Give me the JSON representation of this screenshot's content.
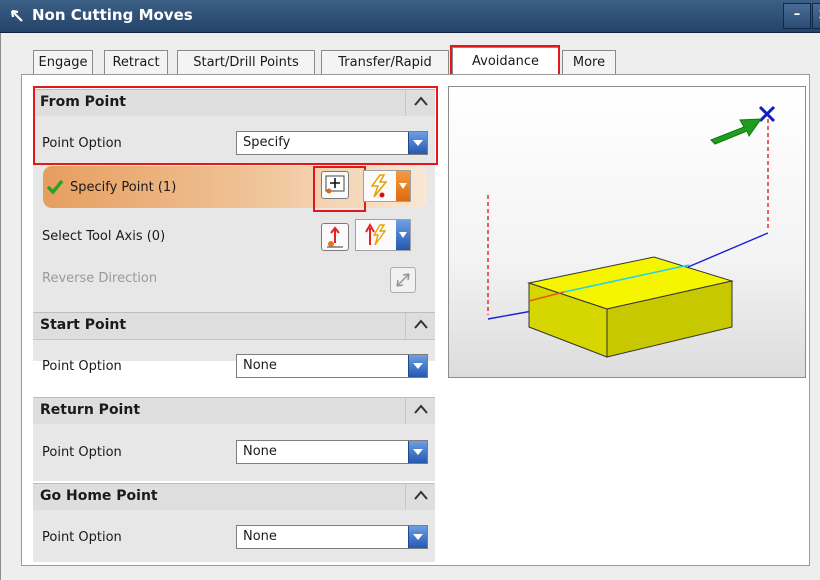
{
  "window": {
    "title": "Non Cutting Moves",
    "minimize_glyph": "–",
    "close_glyph": "x"
  },
  "tabs": [
    {
      "label": "Engage",
      "active": false
    },
    {
      "label": "Retract",
      "active": false
    },
    {
      "label": "Start/Drill Points",
      "active": false
    },
    {
      "label": "Transfer/Rapid",
      "active": false
    },
    {
      "label": "Avoidance",
      "active": true
    },
    {
      "label": "More",
      "active": false
    }
  ],
  "from_point": {
    "header": "From Point",
    "point_option_label": "Point Option",
    "point_option_value": "Specify",
    "specify_point_label": "Specify Point (1)",
    "select_tool_axis_label": "Select Tool Axis (0)",
    "reverse_direction_label": "Reverse Direction"
  },
  "start_point": {
    "header": "Start Point",
    "point_option_label": "Point Option",
    "point_option_value": "None"
  },
  "return_point": {
    "header": "Return Point",
    "point_option_label": "Point Option",
    "point_option_value": "None"
  },
  "go_home_point": {
    "header": "Go Home Point",
    "point_option_label": "Point Option",
    "point_option_value": "None"
  },
  "icons": {
    "collapse": "chevron-up-icon",
    "check": "checkmark-icon",
    "point_dialog": "point-dialog-icon",
    "inferred_point": "inferred-point-icon",
    "vector_dialog": "vector-dialog-icon",
    "inferred_vector": "inferred-vector-icon",
    "reverse": "reverse-direction-icon"
  },
  "colors": {
    "titlebar": "#2d4f78",
    "highlight_box": "#e11919",
    "specify_row": "#e79e5f",
    "dropdown_arrow": "#2f66c2",
    "split_orange": "#f07a14",
    "block_face": "#e8e800",
    "preview_marker": "#0f20c8",
    "direction_arrow": "#1aa61a"
  }
}
